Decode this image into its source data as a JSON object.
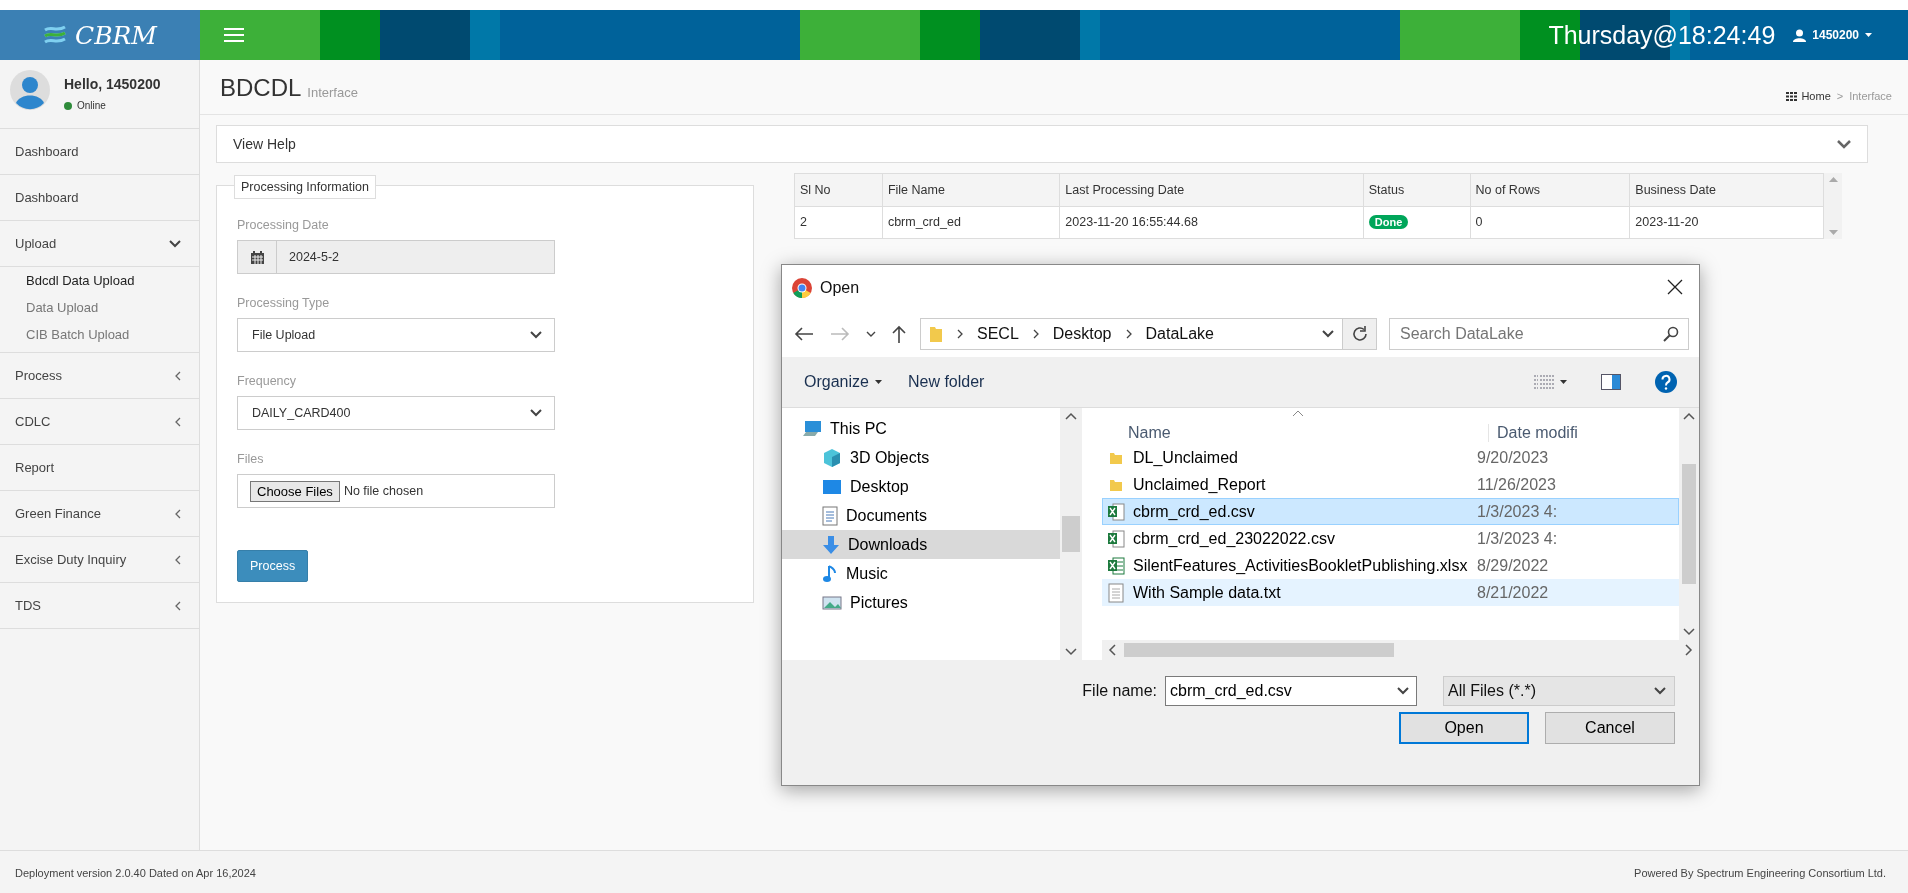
{
  "header": {
    "logo": "CBRM",
    "clock": "Thursday@18:24:49",
    "user": "1450200"
  },
  "profile": {
    "greeting": "Hello, 1450200",
    "status": "Online"
  },
  "sidebar": {
    "items": [
      {
        "label": "Dashboard",
        "kind": "link"
      },
      {
        "label": "Dashboard",
        "kind": "link"
      },
      {
        "label": "Upload",
        "kind": "group",
        "expanded": true,
        "children": [
          {
            "label": "Bdcdl Data Upload",
            "selected": true
          },
          {
            "label": "Data Upload",
            "selected": false
          },
          {
            "label": "CIB Batch Upload",
            "selected": false
          }
        ]
      },
      {
        "label": "Process",
        "kind": "group",
        "expanded": false
      },
      {
        "label": "CDLC",
        "kind": "group",
        "expanded": false
      },
      {
        "label": "Report",
        "kind": "link"
      },
      {
        "label": "Green Finance",
        "kind": "group",
        "expanded": false
      },
      {
        "label": "Excise Duty Inquiry",
        "kind": "group",
        "expanded": false
      },
      {
        "label": "TDS",
        "kind": "group",
        "expanded": false
      }
    ]
  },
  "page": {
    "title": "BDCDL",
    "subtitle": "Interface",
    "breadcrumb": [
      "Home",
      "Interface"
    ],
    "breadcrumb_separator": ">"
  },
  "help_panel": {
    "label": "View Help",
    "expanded": false
  },
  "form": {
    "legend": "Processing Information",
    "fields": [
      {
        "kind": "date",
        "label": "Processing Date",
        "value": "2024-5-2"
      },
      {
        "kind": "select",
        "label": "Processing Type",
        "value": "File Upload"
      },
      {
        "kind": "select",
        "label": "Frequency",
        "value": "DAILY_CARD400"
      },
      {
        "kind": "file",
        "label": "Files",
        "button": "Choose Files",
        "value": "No file chosen"
      }
    ],
    "submit": "Process"
  },
  "table": {
    "columns": [
      "Sl No",
      "File Name",
      "Last Processing Date",
      "Status",
      "No of Rows",
      "Business Date"
    ],
    "rows": [
      {
        "sl_no": "2",
        "file_name": "cbrm_crd_ed",
        "last_processing_date": "2023-11-20 16:55:44.68",
        "status": "Done",
        "no_of_rows": "0",
        "business_date": "2023-11-20"
      }
    ]
  },
  "dialog": {
    "title": "Open",
    "path": [
      "SECL",
      "Desktop",
      "DataLake"
    ],
    "search_placeholder": "Search DataLake",
    "toolbar": {
      "organize": "Organize",
      "new_folder": "New folder"
    },
    "nav": [
      {
        "label": "This PC",
        "kind": "pc",
        "selected": false,
        "children": [
          {
            "label": "3D Objects",
            "kind": "objects",
            "selected": false
          },
          {
            "label": "Desktop",
            "kind": "desktop",
            "selected": false
          },
          {
            "label": "Documents",
            "kind": "documents",
            "selected": false
          },
          {
            "label": "Downloads",
            "kind": "downloads",
            "selected": true
          },
          {
            "label": "Music",
            "kind": "music",
            "selected": false
          },
          {
            "label": "Pictures",
            "kind": "pictures",
            "selected": false
          }
        ]
      }
    ],
    "columns": [
      "Name",
      "Date modifi"
    ],
    "files": [
      {
        "name": "DL_Unclaimed",
        "date": "9/20/2023",
        "kind": "folder",
        "selected": false,
        "hovered": false
      },
      {
        "name": "Unclaimed_Report",
        "date": "11/26/2023",
        "kind": "folder",
        "selected": false,
        "hovered": false
      },
      {
        "name": "cbrm_crd_ed.csv",
        "date": "1/3/2023 4:",
        "kind": "csv",
        "selected": true,
        "hovered": false
      },
      {
        "name": "cbrm_crd_ed_23022022.csv",
        "date": "1/3/2023 4:",
        "kind": "csv",
        "selected": false,
        "hovered": false
      },
      {
        "name": "SilentFeatures_ActivitiesBookletPublishing.xlsx",
        "date": "8/29/2022",
        "kind": "xlsx",
        "selected": false,
        "hovered": false
      },
      {
        "name": "With Sample data.txt",
        "date": "8/21/2022",
        "kind": "txt",
        "selected": false,
        "hovered": true
      }
    ],
    "file_name_label": "File name:",
    "file_name": "cbrm_crd_ed.csv",
    "file_type": "All Files (*.*)",
    "buttons": [
      {
        "label": "Open",
        "kind": "primary"
      },
      {
        "label": "Cancel",
        "kind": "secondary"
      }
    ]
  },
  "footer": {
    "left": "Deployment version 2.0.40 Dated on Apr 16,2024",
    "right": "Powered By Spectrum Engineering Consortium Ltd."
  }
}
